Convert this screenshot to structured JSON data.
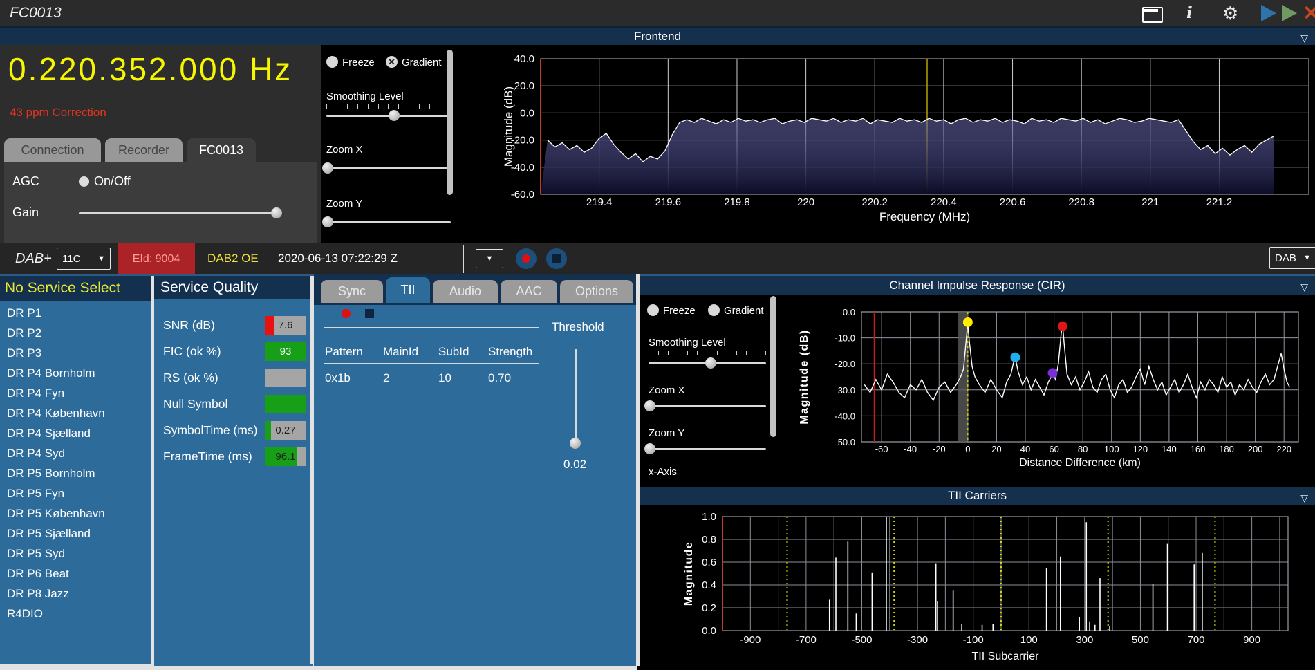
{
  "titlebar": {
    "title": "FC0013",
    "icons": [
      "window-icon",
      "info-icon",
      "gear-icon",
      "play-blue-icon",
      "play-green-icon",
      "close-red-icon"
    ]
  },
  "frontend": {
    "header": "Frontend",
    "frequency": "0.220.352.000 Hz",
    "correction": "43 ppm Correction",
    "tabs": [
      {
        "label": "Connection",
        "active": false
      },
      {
        "label": "Recorder",
        "active": false
      },
      {
        "label": "FC0013",
        "active": true
      }
    ],
    "agc_label": "AGC",
    "agc_toggle": "On/Off",
    "gain_label": "Gain",
    "freeze_label": "Freeze",
    "gradient_label": "Gradient",
    "gradient_checked": "✕",
    "smoothing_label": "Smoothing Level",
    "zoom_x_label": "Zoom X",
    "zoom_y_label": "Zoom Y"
  },
  "dab_bar": {
    "mode": "DAB+",
    "channel": "11C",
    "eid": "EId: 9004",
    "ensemble": "DAB2 OE",
    "timestamp": "2020-06-13  07:22:29 Z",
    "band": "DAB",
    "caret": "▼"
  },
  "services": {
    "header": "No Service Select",
    "items": [
      "DR P1",
      "DR P2",
      "DR P3",
      "DR P4 Bornholm",
      "DR P4 Fyn",
      "DR P4 København",
      "DR P4 Sjælland",
      "DR P4 Syd",
      "DR P5 Bornholm",
      "DR P5 Fyn",
      "DR P5 København",
      "DR P5 Sjælland",
      "DR P5 Syd",
      "DR P6 Beat",
      "DR P8 Jazz",
      "R4DIO"
    ]
  },
  "service_quality": {
    "header": "Service Quality",
    "rows": [
      {
        "label": "SNR (dB)",
        "value": "7.6",
        "segments": [
          {
            "color": "#e81010",
            "w": 0.2
          },
          {
            "color": "#a5a5a5",
            "w": 0.8
          }
        ],
        "value_color": "#1d1d1d"
      },
      {
        "label": "FIC (ok %)",
        "value": "93",
        "segments": [
          {
            "color": "#17a017",
            "w": 1
          }
        ],
        "value_color": "#ffffff"
      },
      {
        "label": "RS (ok %)",
        "value": "",
        "segments": [
          {
            "color": "#a5a5a5",
            "w": 1
          }
        ],
        "value_color": "#ffffff"
      },
      {
        "label": "Null Symbol",
        "value": "",
        "segments": [
          {
            "color": "#17a017",
            "w": 1
          }
        ],
        "value_color": "#ffffff"
      },
      {
        "label": "SymbolTime (ms)",
        "value": "0.27",
        "segments": [
          {
            "color": "#17a017",
            "w": 0.13
          },
          {
            "color": "#a5a5a5",
            "w": 0.87
          }
        ],
        "value_color": "#1d1d1d"
      },
      {
        "label": "FrameTime (ms)",
        "value": "96.1",
        "segments": [
          {
            "color": "#17a017",
            "w": 0.8
          },
          {
            "color": "#a5a5a5",
            "w": 0.2
          }
        ],
        "value_color": "#1d1d1d"
      }
    ]
  },
  "tii_panel": {
    "tabs": [
      {
        "label": "Sync",
        "active": false
      },
      {
        "label": "TII",
        "active": true
      },
      {
        "label": "Audio",
        "active": false
      },
      {
        "label": "AAC",
        "active": false
      },
      {
        "label": "Options",
        "active": false
      }
    ],
    "threshold_label": "Threshold",
    "threshold_value": "0.02",
    "table": {
      "headers": [
        "Pattern",
        "MainId",
        "SubId",
        "Strength"
      ],
      "rows": [
        [
          "0x1b",
          "2",
          "10",
          "0.70"
        ]
      ]
    }
  },
  "cir_panel": {
    "title": "Channel Impulse Response (CIR)",
    "freeze_label": "Freeze",
    "gradient_label": "Gradient",
    "smoothing_label": "Smoothing Level",
    "zoom_x_label": "Zoom X",
    "zoom_y_label": "Zoom Y",
    "x_axis_label": "x-Axis"
  },
  "tii_carriers_panel": {
    "title": "TII Carriers"
  },
  "colors": {
    "accent_navy": "#15304d",
    "panel_blue": "#2d6b9a",
    "freq_yellow": "#f6f600",
    "alert_red": "#e23420",
    "eid_red": "#ab2227",
    "ensemble_yellow": "#f2e23c",
    "bar_green": "#17a017",
    "bar_gray": "#a5a5a5",
    "bar_red": "#e81010"
  },
  "chart_data": [
    {
      "id": "spectrum",
      "type": "area",
      "title": "Frontend",
      "xlabel": "Frequency (MHz)",
      "ylabel": "Magnitude (dB)",
      "xlim": [
        219.23,
        221.46
      ],
      "ylim": [
        -60,
        40
      ],
      "xticks": [
        "219.4",
        "219.6",
        "219.8",
        "220",
        "220.2",
        "220.4",
        "220.6",
        "220.8",
        "221",
        "221.2"
      ],
      "yticks": [
        "40.0",
        "20.0",
        "0.0",
        "-20.0",
        "-40.0",
        "-60.0"
      ],
      "marker_line_x": 220.352,
      "x0": 219.25,
      "dx": 0.0213,
      "values": [
        -20,
        -25,
        -22,
        -27,
        -24,
        -29,
        -26,
        -19,
        -15,
        -23,
        -29,
        -34,
        -30,
        -36,
        -32,
        -34,
        -28,
        -16,
        -7,
        -5,
        -7,
        -4,
        -6,
        -8,
        -5,
        -7,
        -4,
        -6,
        -5,
        -7,
        -5,
        -4,
        -8,
        -6,
        -5,
        -7,
        -4,
        -5,
        -6,
        -4,
        -7,
        -5,
        -6,
        -4,
        -8,
        -5,
        -6,
        -7,
        -4,
        -6,
        -5,
        -7,
        -4,
        -6,
        -5,
        -8,
        -5,
        -4,
        -7,
        -5,
        -6,
        -4,
        -7,
        -5,
        -6,
        -8,
        -4,
        -6,
        -5,
        -7,
        -4,
        -5,
        -6,
        -4,
        -7,
        -5,
        -8,
        -6,
        -4,
        -5,
        -7,
        -6,
        -4,
        -5,
        -6,
        -7,
        -5,
        -13,
        -21,
        -27,
        -24,
        -30,
        -26,
        -31,
        -27,
        -24,
        -29,
        -23,
        -20,
        -17
      ]
    },
    {
      "id": "cir",
      "type": "line",
      "title": "Channel Impulse Response (CIR)",
      "xlabel": "Distance Difference (km)",
      "ylabel": "Magnitude (dB)",
      "xlim": [
        -74,
        230
      ],
      "ylim": [
        -50,
        0
      ],
      "xticks": [
        "-60",
        "-40",
        "-20",
        "0",
        "20",
        "40",
        "60",
        "80",
        "100",
        "120",
        "140",
        "160",
        "180",
        "200",
        "220"
      ],
      "yticks": [
        "0.0",
        "-10.0",
        "-20.0",
        "-30.0",
        "-40.0",
        "-50.0"
      ],
      "red_line_x": -65,
      "band": [
        -7,
        -0.5
      ],
      "dashed_line_x": 0,
      "points": [
        [
          -72,
          -28
        ],
        [
          -68,
          -31
        ],
        [
          -64,
          -26
        ],
        [
          -60,
          -30
        ],
        [
          -56,
          -24
        ],
        [
          -52,
          -27
        ],
        [
          -48,
          -31
        ],
        [
          -44,
          -33
        ],
        [
          -40,
          -28
        ],
        [
          -36,
          -30
        ],
        [
          -32,
          -26
        ],
        [
          -28,
          -31
        ],
        [
          -24,
          -34
        ],
        [
          -20,
          -29
        ],
        [
          -16,
          -27
        ],
        [
          -12,
          -31
        ],
        [
          -8,
          -28
        ],
        [
          -5,
          -25
        ],
        [
          -3,
          -22
        ],
        [
          -1,
          -10
        ],
        [
          0,
          -4
        ],
        [
          1,
          -11
        ],
        [
          3,
          -21
        ],
        [
          5,
          -25
        ],
        [
          8,
          -28
        ],
        [
          12,
          -31
        ],
        [
          16,
          -26
        ],
        [
          20,
          -30
        ],
        [
          24,
          -33
        ],
        [
          27,
          -27
        ],
        [
          30,
          -24
        ],
        [
          32,
          -19
        ],
        [
          33,
          -17.5
        ],
        [
          35,
          -23
        ],
        [
          38,
          -28
        ],
        [
          41,
          -25
        ],
        [
          44,
          -30
        ],
        [
          47,
          -26
        ],
        [
          50,
          -29
        ],
        [
          53,
          -32
        ],
        [
          56,
          -27
        ],
        [
          58,
          -25
        ],
        [
          59,
          -23.5
        ],
        [
          61,
          -26
        ],
        [
          63,
          -20
        ],
        [
          65,
          -8
        ],
        [
          66,
          -5.5
        ],
        [
          67,
          -12
        ],
        [
          69,
          -24
        ],
        [
          72,
          -28
        ],
        [
          75,
          -25
        ],
        [
          78,
          -30
        ],
        [
          81,
          -27
        ],
        [
          84,
          -23
        ],
        [
          87,
          -29
        ],
        [
          90,
          -31
        ],
        [
          93,
          -26
        ],
        [
          96,
          -24
        ],
        [
          99,
          -30
        ],
        [
          102,
          -33
        ],
        [
          105,
          -28
        ],
        [
          108,
          -26
        ],
        [
          111,
          -31
        ],
        [
          114,
          -29
        ],
        [
          117,
          -25
        ],
        [
          120,
          -22
        ],
        [
          123,
          -28
        ],
        [
          126,
          -21
        ],
        [
          129,
          -26
        ],
        [
          132,
          -30
        ],
        [
          135,
          -27
        ],
        [
          138,
          -32
        ],
        [
          141,
          -29
        ],
        [
          144,
          -26
        ],
        [
          147,
          -31
        ],
        [
          150,
          -28
        ],
        [
          153,
          -24
        ],
        [
          156,
          -29
        ],
        [
          159,
          -33
        ],
        [
          162,
          -27
        ],
        [
          165,
          -30
        ],
        [
          168,
          -26
        ],
        [
          171,
          -28
        ],
        [
          174,
          -31
        ],
        [
          177,
          -25
        ],
        [
          180,
          -29
        ],
        [
          183,
          -27
        ],
        [
          186,
          -32
        ],
        [
          189,
          -28
        ],
        [
          192,
          -30
        ],
        [
          195,
          -26
        ],
        [
          198,
          -29
        ],
        [
          201,
          -31
        ],
        [
          204,
          -27
        ],
        [
          207,
          -24
        ],
        [
          210,
          -28
        ],
        [
          213,
          -26
        ],
        [
          216,
          -20
        ],
        [
          218,
          -16
        ],
        [
          220,
          -22
        ],
        [
          222,
          -27
        ],
        [
          224,
          -29
        ]
      ],
      "markers": [
        {
          "x": 0,
          "y": -4,
          "color": "#ffee00"
        },
        {
          "x": 33,
          "y": -17.5,
          "color": "#1fb0f0"
        },
        {
          "x": 59,
          "y": -23.5,
          "color": "#7a30d8"
        },
        {
          "x": 66,
          "y": -5.5,
          "color": "#e01515"
        }
      ]
    },
    {
      "id": "tii",
      "type": "stem",
      "title": "TII Carriers",
      "xlabel": "TII Subcarrier",
      "ylabel": "Magnitude",
      "xlim": [
        -1000,
        1030
      ],
      "ylim": [
        0,
        1
      ],
      "xticks": [
        "-900",
        "-700",
        "-500",
        "-300",
        "-100",
        "100",
        "300",
        "500",
        "700",
        "900"
      ],
      "yticks": [
        "0.0",
        "0.2",
        "0.4",
        "0.6",
        "0.8",
        "1.0"
      ],
      "grid_x_step": 100,
      "dotted_lines_x": [
        -768,
        -384,
        0,
        384,
        768
      ],
      "stems": [
        [
          -616,
          0.27
        ],
        [
          -593,
          0.64
        ],
        [
          -550,
          0.78
        ],
        [
          -520,
          0.15
        ],
        [
          -463,
          0.51
        ],
        [
          -412,
          1.0
        ],
        [
          -234,
          0.59
        ],
        [
          -228,
          0.26
        ],
        [
          -172,
          0.35
        ],
        [
          -141,
          0.06
        ],
        [
          -68,
          0.05
        ],
        [
          -29,
          0.06
        ],
        [
          163,
          0.55
        ],
        [
          213,
          0.65
        ],
        [
          281,
          0.12
        ],
        [
          306,
          0.95
        ],
        [
          318,
          0.08
        ],
        [
          337,
          0.05
        ],
        [
          355,
          0.46
        ],
        [
          390,
          0.04
        ],
        [
          545,
          0.41
        ],
        [
          597,
          0.76
        ],
        [
          693,
          0.58
        ],
        [
          722,
          0.68
        ]
      ]
    }
  ]
}
